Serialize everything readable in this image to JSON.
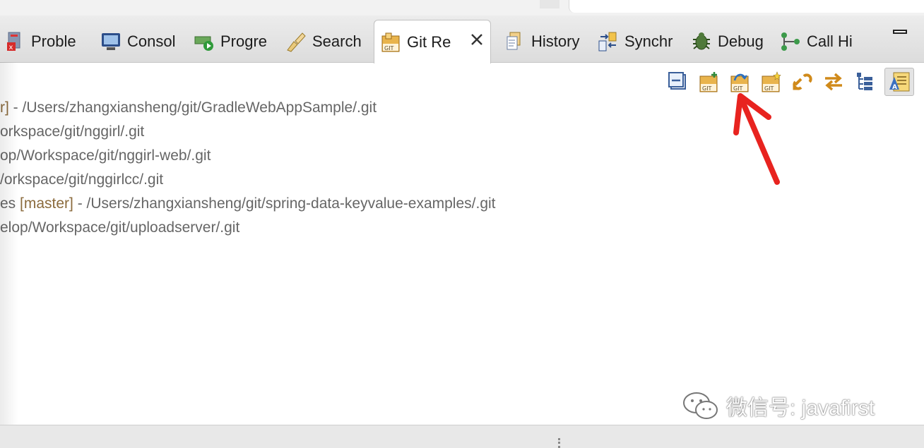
{
  "tabs": [
    {
      "label": "Proble",
      "icon": "problems-icon"
    },
    {
      "label": "Consol",
      "icon": "console-icon"
    },
    {
      "label": "Progre",
      "icon": "progress-icon"
    },
    {
      "label": "Search",
      "icon": "search-icon"
    },
    {
      "label": "Git Re",
      "icon": "git-repositories-icon",
      "active": true
    },
    {
      "label": "History",
      "icon": "history-icon"
    },
    {
      "label": "Synchr",
      "icon": "synchronize-icon"
    },
    {
      "label": "Debug",
      "icon": "debug-icon"
    },
    {
      "label": "Call Hi",
      "icon": "call-hierarchy-icon"
    }
  ],
  "toolbar": [
    "collapse-all-icon",
    "add-repository-icon",
    "clone-repository-icon",
    "create-repository-icon",
    "link-with-selection-icon",
    "link-with-editor-icon",
    "hierarchical-branch-layout-icon",
    "view-menu-icon"
  ],
  "repos": [
    {
      "prefix": "r]",
      "path": " - /Users/zhangxiansheng/git/GradleWebAppSample/.git"
    },
    {
      "prefix": "",
      "path": "orkspace/git/nggirl/.git"
    },
    {
      "prefix": "",
      "path": "op/Workspace/git/nggirl-web/.git"
    },
    {
      "prefix": "",
      "path": "/orkspace/git/nggirlcc/.git"
    },
    {
      "prefix": "es ",
      "branch": "[master]",
      "path": " - /Users/zhangxiansheng/git/spring-data-keyvalue-examples/.git"
    },
    {
      "prefix": "",
      "path": "elop/Workspace/git/uploadserver/.git"
    }
  ],
  "watermark": "微信号: javafirst",
  "colors": {
    "arrow": "#e8231f",
    "branch": "#8b6b3d",
    "path": "#666666"
  }
}
